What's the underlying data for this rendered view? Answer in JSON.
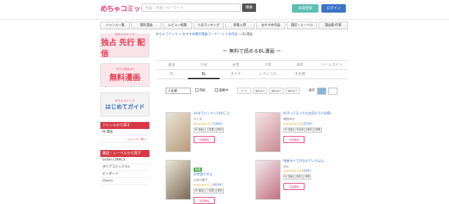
{
  "header": {
    "logo": "めちゃコミック",
    "logo_sub": "めちゃコミック",
    "search_placeholder": "作品・作家・キーワード",
    "search_button": "検索",
    "register_button": "会員登録",
    "login_button": "ログイン"
  },
  "nav": [
    "ジャンル一覧",
    "無料漫画",
    "レビュー総覧",
    "人気ランキング",
    "新着入荷",
    "おすすめ作品",
    "雑誌・レーベル",
    "漫画家/作家"
  ],
  "sidebar": {
    "banner1_top": "めちゃコミック",
    "banner1_main": "独占 先行 配信",
    "banner2_top": "今すぐ読める!",
    "banner2_main": "無料漫画",
    "banner3_top": "めちゃコミック",
    "banner3_main": "はじめてガイド",
    "genre_head": "ジャンルから探す",
    "genre_item": "BL漫画",
    "genre_more": "ジャンル一覧へ",
    "magazine_head": "雑誌・レーベルから探す",
    "magazine_items": [
      "GUSH COMICS",
      "ダリアコミックスe",
      "ビーボーイ",
      "Cheri+"
    ]
  },
  "main": {
    "breadcrumb": [
      "めちゃコミック",
      "おすすめ無料漫画コーナー",
      "人気作品",
      "BL漫画"
    ],
    "title": "ー 無料で読めるBL漫画 ー",
    "tabs": [
      "総合",
      "少女",
      "女性",
      "少年",
      "青年",
      "ハーレクイン",
      "TL",
      "BL",
      "オトナ",
      "レディコミ",
      "その他",
      ""
    ],
    "sort_select": "人気順",
    "check_complete": "完結",
    "check_ongoing": "連載中",
    "seg1": "すべて",
    "seg2": "無料あり",
    "seg3": "無料あり",
    "seg4": "無料あり",
    "display_label": "表示"
  },
  "cards": [
    {
      "title": "40までにしたい10のこと",
      "author": "マミタ",
      "rating": "★★★★★ 4.7",
      "count": "(536件)",
      "tags": [
        "BL漫画",
        "上田屋",
        "無料"
      ],
      "free": "1話無料",
      "badge": ""
    },
    {
      "title": "好きって言ったのお前だろ?(分冊)",
      "author": "梅田みか",
      "rating": "★★★★★ 4.4",
      "count": "(255件)",
      "tags": [
        "BL漫画",
        "完全版",
        "無料",
        "続巻"
      ],
      "free": "1話無料",
      "badge": ""
    },
    {
      "title": "お世話ですよ",
      "author": "山本小鉄子",
      "rating": "★★★★★ 4.3",
      "count": "(663件)",
      "tags": [
        "BL漫画",
        "上田屋",
        "無料"
      ],
      "free": "3話無料",
      "badge": "新着"
    },
    {
      "title": "性癖すべてのなかでいちばん、",
      "author": "kuri",
      "rating": "★★★★★ 3.8",
      "count": "(24件)",
      "tags": [
        "BL漫画",
        "無料",
        "続巻"
      ],
      "free": "1話無料",
      "badge": ""
    }
  ]
}
